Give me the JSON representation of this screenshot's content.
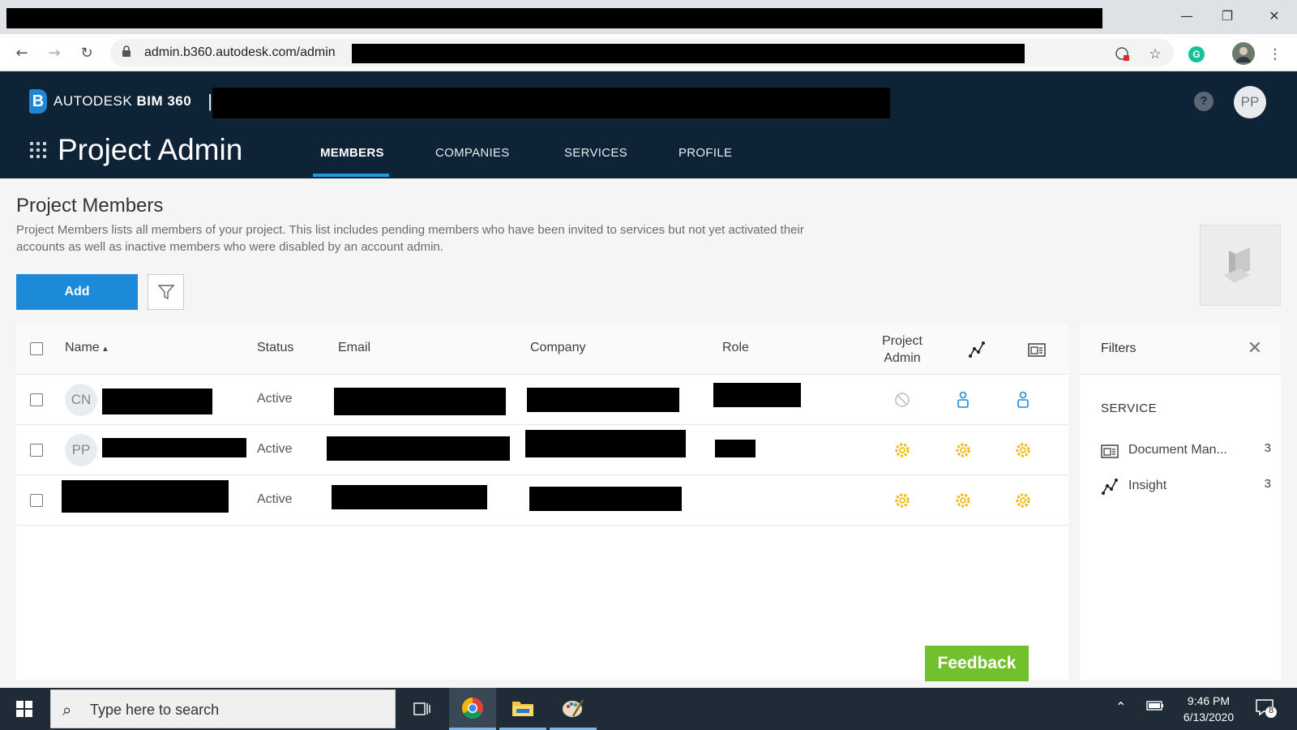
{
  "browser": {
    "url": "admin.b360.autodesk.com/admin",
    "window_controls": {
      "minimize": "—",
      "restore": "❐",
      "close": "✕"
    }
  },
  "header": {
    "brand_prefix": "AUTODESK",
    "brand_product": "BIM 360",
    "brand_separator": "|",
    "module_title": "Project Admin",
    "user_initials": "PP",
    "help_label": "?",
    "tabs": [
      {
        "label": "MEMBERS",
        "active": true
      },
      {
        "label": "COMPANIES",
        "active": false
      },
      {
        "label": "SERVICES",
        "active": false
      },
      {
        "label": "PROFILE",
        "active": false
      }
    ]
  },
  "page": {
    "title": "Project Members",
    "description": "Project Members lists all members of your project. This list includes pending members who have been invited to services but not yet activated their accounts as well as inactive members who were disabled by an account admin.",
    "add_label": "Add"
  },
  "table": {
    "columns": {
      "name": "Name",
      "sort_indicator": "▴",
      "status": "Status",
      "email": "Email",
      "company": "Company",
      "role": "Role",
      "project_admin_line1": "Project",
      "project_admin_line2": "Admin"
    },
    "rows": [
      {
        "initials": "CN",
        "status": "Active",
        "project_admin": "none-icon",
        "insight": "member-icon",
        "document_management": "member-icon"
      },
      {
        "initials": "PP",
        "status": "Active",
        "project_admin": "admin-gear-icon",
        "insight": "admin-gear-icon",
        "document_management": "admin-gear-icon"
      },
      {
        "initials": "",
        "status": "Active",
        "project_admin": "admin-gear-icon",
        "insight": "admin-gear-icon",
        "document_management": "admin-gear-icon"
      }
    ]
  },
  "filters": {
    "title": "Filters",
    "section": "SERVICE",
    "items": [
      {
        "label": "Document Man...",
        "count": "3",
        "icon": "document-management-icon"
      },
      {
        "label": "Insight",
        "count": "3",
        "icon": "insight-icon"
      }
    ]
  },
  "feedback_label": "Feedback",
  "taskbar": {
    "search_placeholder": "Type here to search",
    "time": "9:46 PM",
    "date": "6/13/2020",
    "notification_count": "8"
  },
  "colors": {
    "header_bg": "#0e2336",
    "accent_blue": "#1c8ad8",
    "admin_gear": "#f2b705",
    "member_icon": "#1c8ad8",
    "feedback_green": "#72c02c"
  }
}
